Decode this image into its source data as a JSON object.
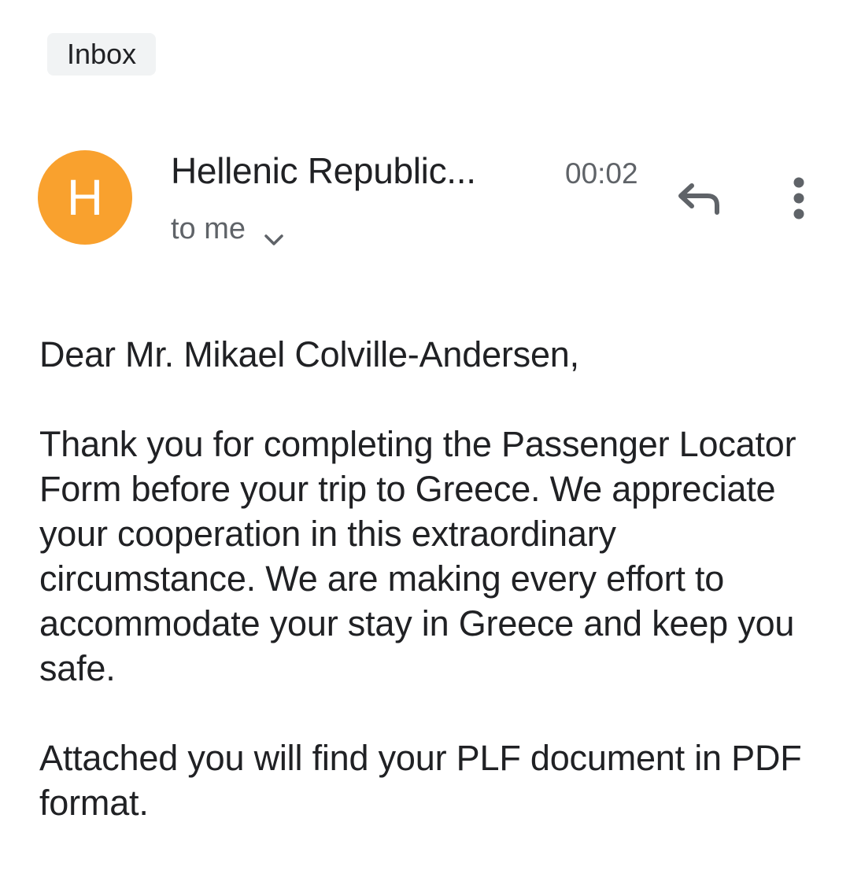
{
  "label": "Inbox",
  "sender": {
    "initial": "H",
    "name": "Hellenic Republic...",
    "time": "00:02",
    "recipient": "to me",
    "avatar_color": "#f9a12e"
  },
  "icons": {
    "reply": "reply-icon",
    "more": "more-vert-icon",
    "expand": "chevron-down-icon"
  },
  "body": {
    "greeting": "Dear Mr. Mikael Colville-Andersen,",
    "paragraph_1": "Thank you for completing the Passenger Locator Form before your trip to Greece. We appreciate your cooperation in this extraordinary circumstance. We are making every effort to accommodate your stay in Greece and keep you safe.",
    "paragraph_2": "Attached you will find your PLF document in PDF format."
  }
}
